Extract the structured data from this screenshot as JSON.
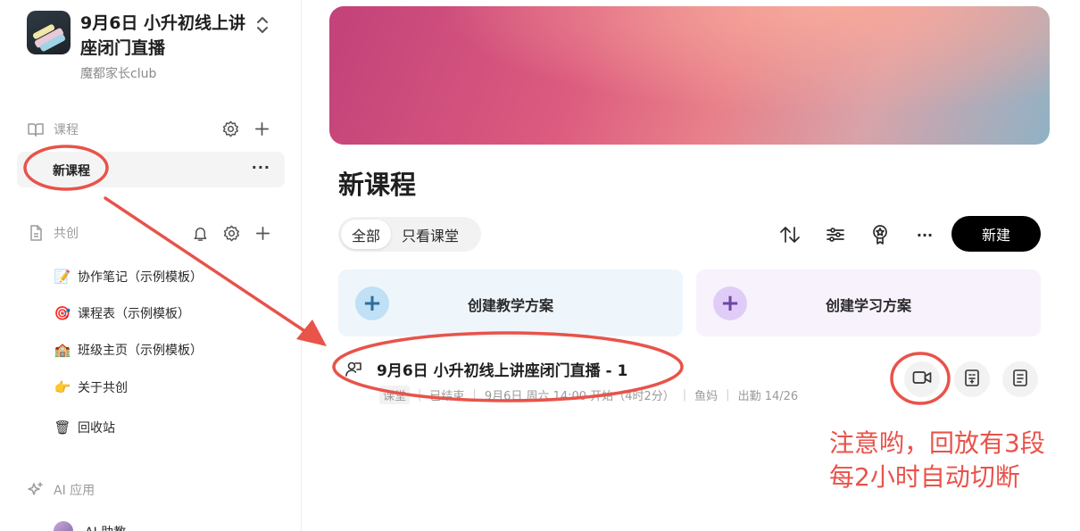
{
  "workspace": {
    "title": "9月6日 小升初线上讲座闭门直播",
    "subtitle": "魔都家长club"
  },
  "sidebar": {
    "courses_section": {
      "label": "课程"
    },
    "active_course": {
      "label": "新课程",
      "more": "···"
    },
    "cocreate_section": {
      "label": "共创"
    },
    "cocreate_items": [
      {
        "label": "协作笔记（示例模板）",
        "icon": "📝"
      },
      {
        "label": "课程表（示例模板）",
        "icon": "🎯"
      },
      {
        "label": "班级主页（示例模板）",
        "icon": "🏫"
      },
      {
        "label": "关于共创",
        "icon": "👉"
      },
      {
        "label": "回收站",
        "icon": "🗑"
      }
    ],
    "ai_section": {
      "label": "AI 应用"
    },
    "ai_items": [
      {
        "label": "AI 助教"
      }
    ]
  },
  "main": {
    "page_title": "新课程",
    "filters": {
      "all": "全部",
      "class_only": "只看课堂"
    },
    "toolbar": {
      "more": "···",
      "new_button": "新建"
    },
    "cards": [
      {
        "label": "创建教学方案",
        "bg": "#eef6fc",
        "accent": "#bfe0f5"
      },
      {
        "label": "创建学习方案",
        "bg": "#f8f2fd",
        "accent": "#e0cdf7"
      }
    ],
    "lesson": {
      "title": "9月6日 小升初线上讲座闭门直播 - 1",
      "type_tag": "课堂",
      "status": "已结束",
      "start": "9月6日 周六 14:00 开始（4时2分）",
      "teacher": "鱼妈",
      "attendance": "出勤 14/26"
    }
  },
  "annotation": {
    "note_line1": "注意哟，回放有3段",
    "note_line2": "每2小时自动切断",
    "color": "#e8534a"
  }
}
